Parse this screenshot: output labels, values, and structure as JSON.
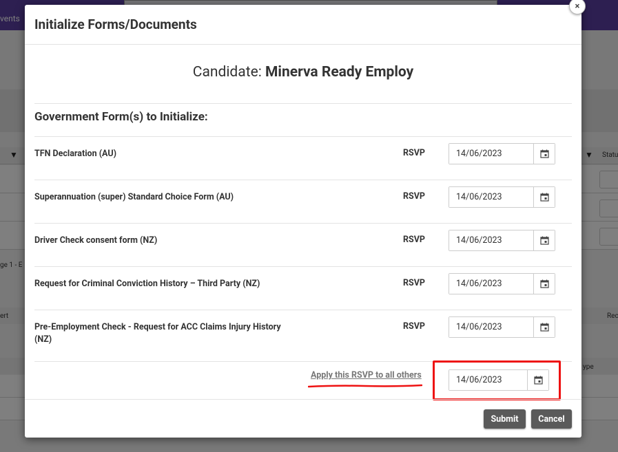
{
  "background": {
    "nav_text": "vents",
    "page_hint": "ge 1 - E",
    "col_a": "ert",
    "col_b": "Rec",
    "col_status": "Statu",
    "col_type": "ype"
  },
  "modal": {
    "title": "Initialize Forms/Documents",
    "close_label": "×",
    "candidate_prefix": "Candidate: ",
    "candidate_name": "Minerva Ready Employ",
    "section_title": "Government Form(s) to Initialize:",
    "rsvp_label": "RSVP",
    "forms": [
      {
        "name": "TFN Declaration (AU)",
        "date": "14/06/2023"
      },
      {
        "name": "Superannuation (super) Standard Choice Form (AU)",
        "date": "14/06/2023"
      },
      {
        "name": "Driver Check consent form (NZ)",
        "date": "14/06/2023"
      },
      {
        "name": "Request for Criminal Conviction History – Third Party (NZ)",
        "date": "14/06/2023"
      },
      {
        "name": "Pre-Employment Check - Request for ACC Claims Injury History (NZ)",
        "date": "14/06/2023"
      }
    ],
    "apply_all_label": "Apply this RSVP to all others",
    "apply_all_date": "14/06/2023",
    "submit_label": "Submit",
    "cancel_label": "Cancel"
  },
  "colors": {
    "topbar": "#5b3fa3",
    "highlight": "#ee1111",
    "button": "#5a5a5a"
  }
}
